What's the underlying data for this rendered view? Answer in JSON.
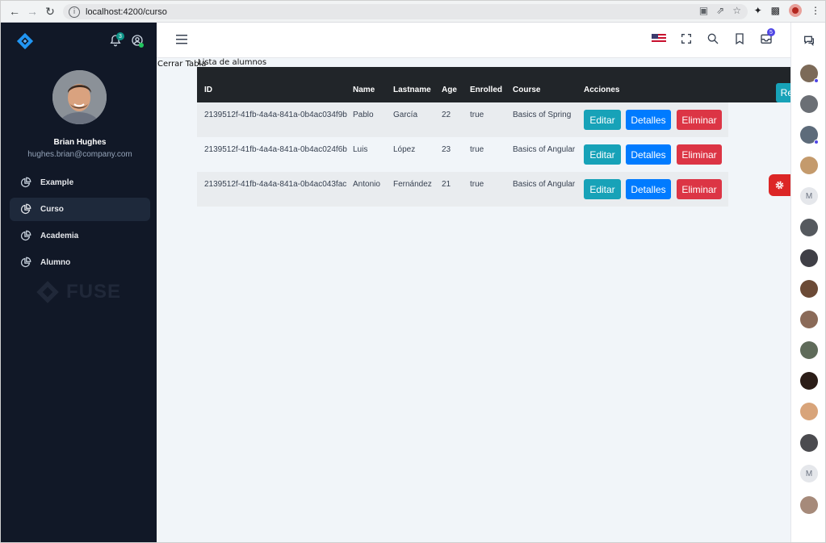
{
  "browser": {
    "url": "localhost:4200/curso"
  },
  "sidebar": {
    "notifications_count": "3",
    "user": {
      "name": "Brian Hughes",
      "email": "hughes.brian@company.com"
    },
    "items": [
      {
        "label": "Example",
        "active": false
      },
      {
        "label": "Curso",
        "active": true
      },
      {
        "label": "Academia",
        "active": false
      },
      {
        "label": "Alumno",
        "active": false
      }
    ],
    "watermark": "FUSE"
  },
  "topbar": {
    "mail_count": "5"
  },
  "main": {
    "close_table_link": "Cerrar Tabla",
    "caption": "Lista de alumnos",
    "register_button": "Registrar",
    "columns": [
      "ID",
      "Name",
      "Lastname",
      "Age",
      "Enrolled",
      "Course",
      "Acciones"
    ],
    "rows": [
      {
        "id": "2139512f-41fb-4a4a-841a-0b4ac034f9b",
        "name": "Pablo",
        "lastname": "García",
        "age": "22",
        "enrolled": "true",
        "course": "Basics of Spring"
      },
      {
        "id": "2139512f-41fb-4a4a-841a-0b4ac024f6b",
        "name": "Luis",
        "lastname": "López",
        "age": "23",
        "enrolled": "true",
        "course": "Basics of Angular"
      },
      {
        "id": "2139512f-41fb-4a4a-841a-0b4ac043fac",
        "name": "Antonio",
        "lastname": "Fernández",
        "age": "21",
        "enrolled": "true",
        "course": "Basics of Angular"
      }
    ],
    "actions": {
      "edit": "Editar",
      "details": "Detalles",
      "delete": "Eliminar"
    }
  },
  "contacts_panel": {
    "letter_avatar_1": "M",
    "letter_avatar_2": "M"
  },
  "colors": {
    "sidebar_bg": "#111827",
    "table_head_bg": "#212529",
    "info": "#17a2b8",
    "primary": "#007bff",
    "danger": "#dc3545"
  }
}
